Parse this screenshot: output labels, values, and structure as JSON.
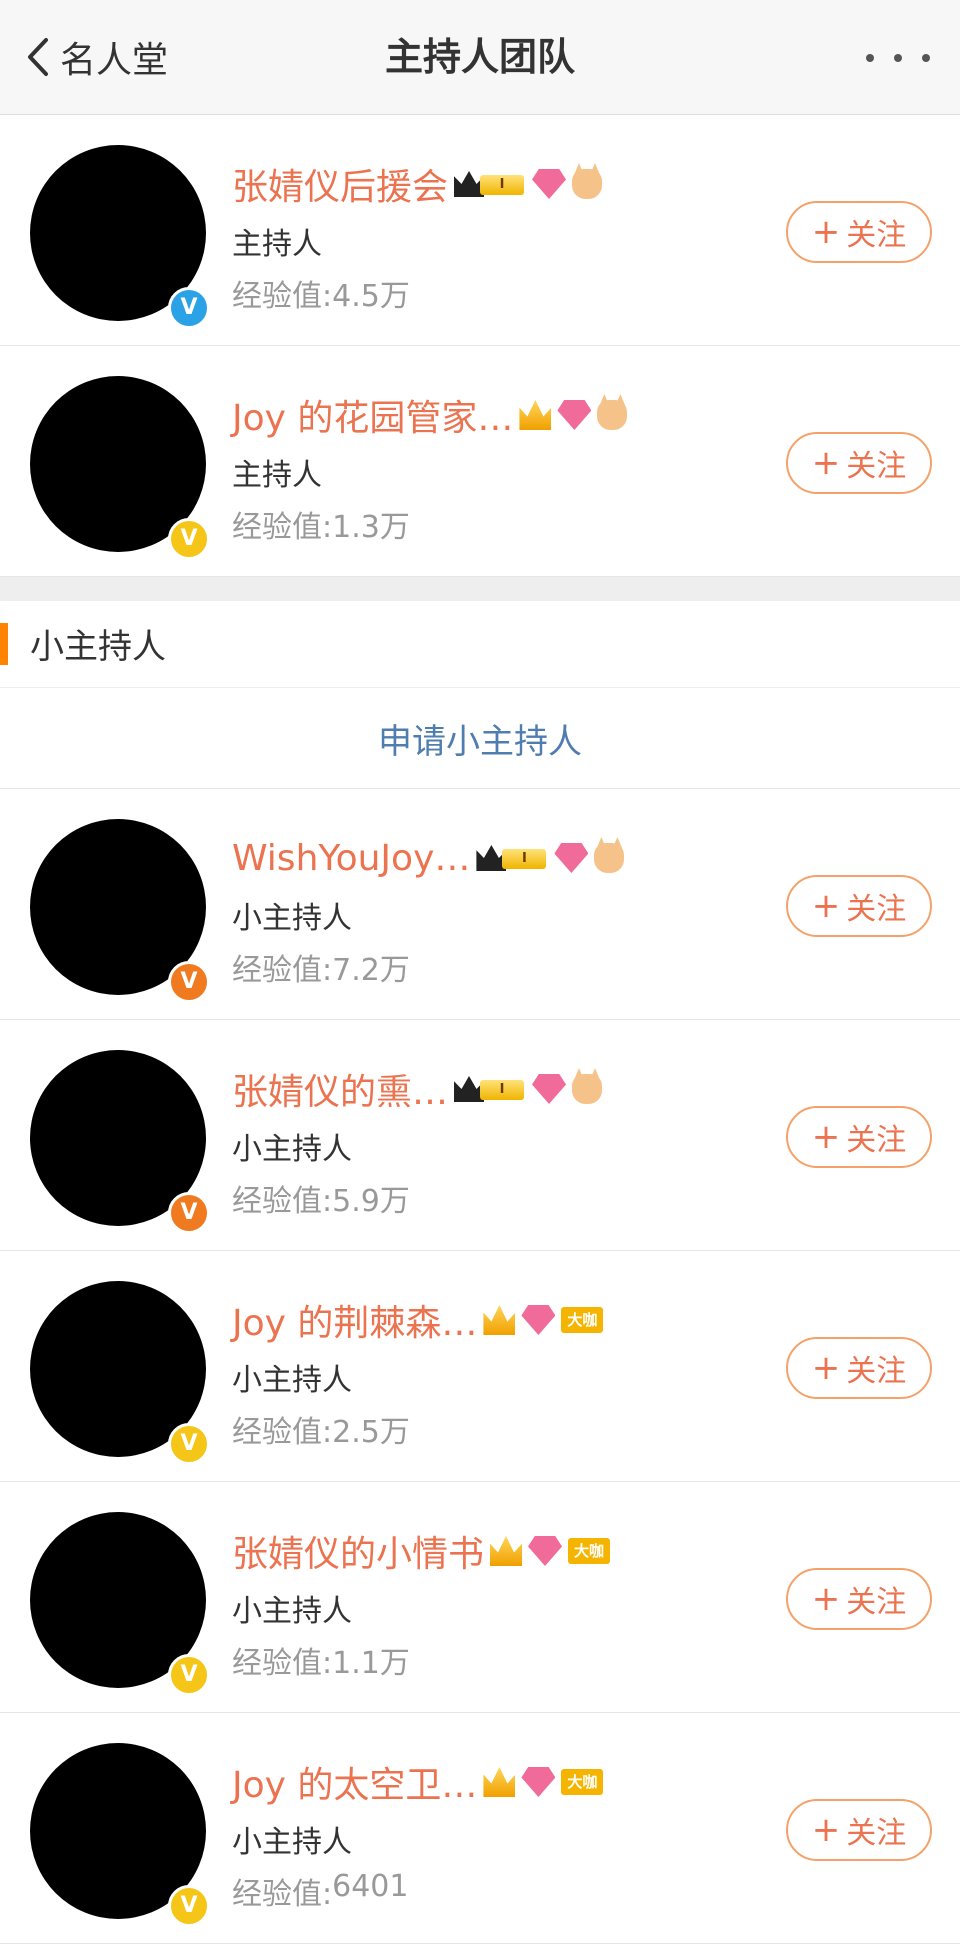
{
  "nav": {
    "back_label": "名人堂",
    "title": "主持人团队"
  },
  "hosts": [
    {
      "name": "张婧仪后援会",
      "role": "主持人",
      "exp_label": "经验值: ",
      "exp_value": "4.5万",
      "follow_label": "关注",
      "badge": "blue",
      "icons": [
        "crown-level",
        "gem",
        "cat"
      ],
      "level_text": "I"
    },
    {
      "name": "Joy 的花园管家…",
      "role": "主持人",
      "exp_label": "经验值: ",
      "exp_value": "1.3万",
      "follow_label": "关注",
      "badge": "gold",
      "icons": [
        "crown",
        "gem",
        "cat"
      ]
    }
  ],
  "section": {
    "title": "小主持人",
    "apply_link": "申请小主持人"
  },
  "small_hosts": [
    {
      "name": "WishYouJoy…",
      "role": "小主持人",
      "exp_label": "经验值: ",
      "exp_value": "7.2万",
      "follow_label": "关注",
      "badge": "orange",
      "icons": [
        "crown-level",
        "gem",
        "cat"
      ],
      "level_text": "I"
    },
    {
      "name": "张婧仪的熏…",
      "role": "小主持人",
      "exp_label": "经验值: ",
      "exp_value": "5.9万",
      "follow_label": "关注",
      "badge": "orange",
      "icons": [
        "crown-level",
        "gem",
        "cat"
      ],
      "level_text": "I"
    },
    {
      "name": "Joy 的荆棘森…",
      "role": "小主持人",
      "exp_label": "经验值: ",
      "exp_value": "2.5万",
      "follow_label": "关注",
      "badge": "gold",
      "icons": [
        "crown",
        "gem",
        "daka"
      ],
      "daka_text": "大咖"
    },
    {
      "name": "张婧仪的小情书",
      "role": "小主持人",
      "exp_label": "经验值: ",
      "exp_value": "1.1万",
      "follow_label": "关注",
      "badge": "gold",
      "icons": [
        "crown",
        "gem",
        "daka"
      ],
      "daka_text": "大咖"
    },
    {
      "name": "Joy 的太空卫…",
      "role": "小主持人",
      "exp_label": "经验值: ",
      "exp_value": "6401",
      "follow_label": "关注",
      "badge": "gold",
      "icons": [
        "crown",
        "gem",
        "daka"
      ],
      "daka_text": "大咖"
    }
  ],
  "icons": {
    "back": "chevron-left-icon",
    "more": "more-dots-icon",
    "verified": "verified-v-icon",
    "plus": "plus-icon"
  },
  "colors": {
    "accent": "#ff8200",
    "username": "#eb7350",
    "link": "#507daf",
    "verified_blue": "#2ba1e6",
    "verified_gold": "#f5c518",
    "verified_orange": "#f07a20"
  }
}
